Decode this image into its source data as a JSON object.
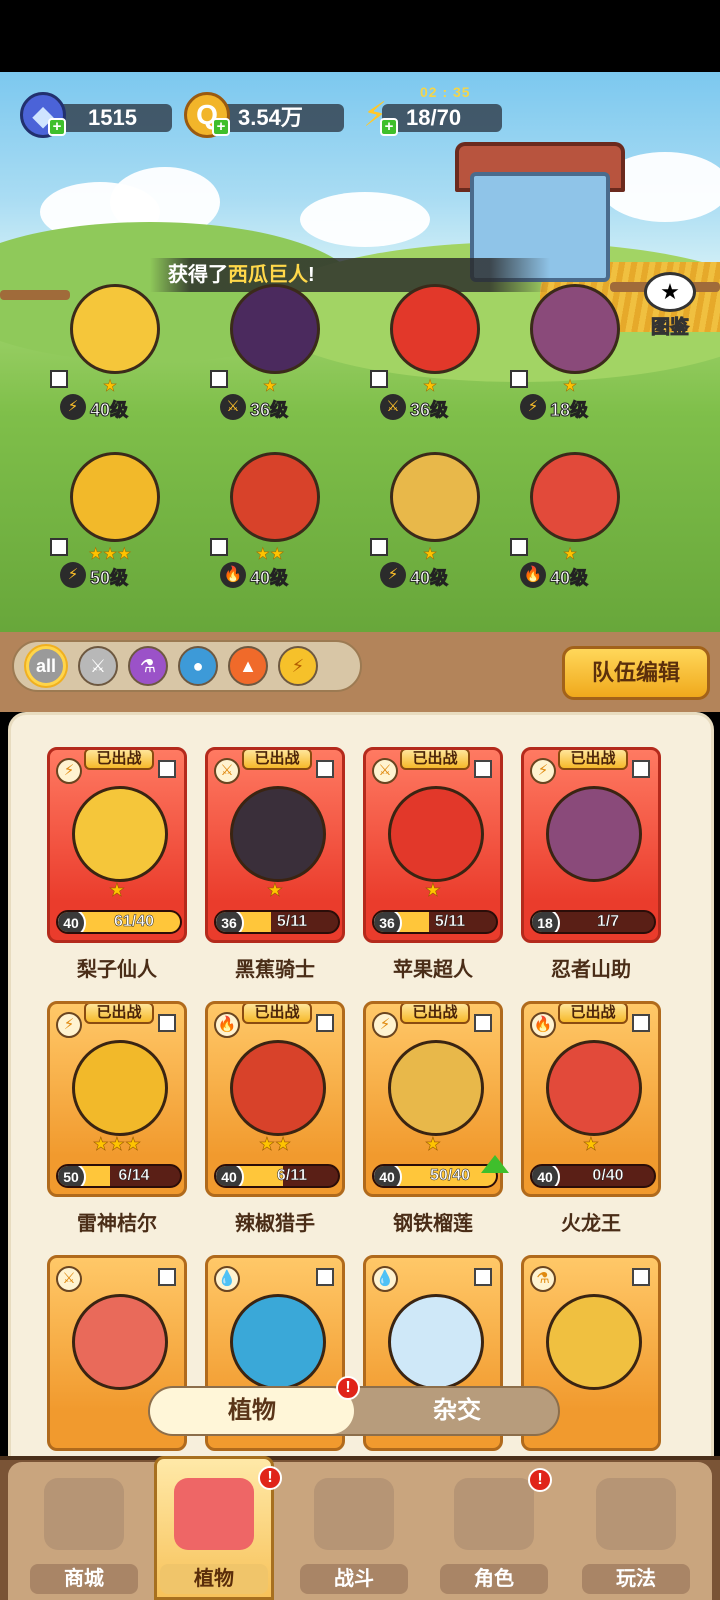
{
  "currency": {
    "gems": "1515",
    "coins": "3.54万",
    "energy": "18/70",
    "energy_timer": "02 : 35"
  },
  "announcement": {
    "prefix": "获得了",
    "highlight": "西瓜巨人",
    "suffix": "!"
  },
  "codex_label": "图鉴",
  "field_plants": [
    {
      "element": "lightning",
      "level": "40级",
      "stars": "★",
      "color": "#f5c63a"
    },
    {
      "element": "sword",
      "level": "36级",
      "stars": "★",
      "color": "#4b2a5e"
    },
    {
      "element": "sword",
      "level": "36级",
      "stars": "★",
      "color": "#e2382a"
    },
    {
      "element": "lightning",
      "level": "18级",
      "stars": "★",
      "color": "#8a4a7a"
    },
    {
      "element": "lightning",
      "level": "50级",
      "stars": "★★★",
      "color": "#f2b92a"
    },
    {
      "element": "fire",
      "level": "40级",
      "stars": "★★",
      "color": "#d8422a"
    },
    {
      "element": "lightning",
      "level": "40级",
      "stars": "★",
      "color": "#e8b84a"
    },
    {
      "element": "fire",
      "level": "40级",
      "stars": "★",
      "color": "#e24a3a"
    }
  ],
  "filters": [
    "all",
    "sword-icon",
    "potion-icon",
    "water-icon",
    "fire-icon",
    "lightning-icon"
  ],
  "team_edit_label": "队伍编辑",
  "deployed_label": "已出战",
  "cards": [
    {
      "name": "梨子仙人",
      "level": "40",
      "progress": "61/40",
      "fill": 1.0,
      "stars": "★",
      "element": "⚡",
      "style": "red",
      "color": "#f5c63a"
    },
    {
      "name": "黑蕉骑士",
      "level": "36",
      "progress": "5/11",
      "fill": 0.45,
      "stars": "★",
      "element": "⚔",
      "style": "red",
      "color": "#3a2f3a"
    },
    {
      "name": "苹果超人",
      "level": "36",
      "progress": "5/11",
      "fill": 0.45,
      "stars": "★",
      "element": "⚔",
      "style": "red",
      "color": "#e2382a"
    },
    {
      "name": "忍者山助",
      "level": "18",
      "progress": "1/7",
      "fill": 0.14,
      "stars": "",
      "element": "⚡",
      "style": "red",
      "color": "#8a4a7a"
    },
    {
      "name": "雷神桔尔",
      "level": "50",
      "progress": "6/14",
      "fill": 0.43,
      "stars": "★★★",
      "element": "⚡",
      "style": "gold",
      "color": "#f2b92a"
    },
    {
      "name": "辣椒猎手",
      "level": "40",
      "progress": "6/11",
      "fill": 0.55,
      "stars": "★★",
      "element": "🔥",
      "style": "gold",
      "color": "#d8422a"
    },
    {
      "name": "钢铁榴莲",
      "level": "40",
      "progress": "50/40",
      "fill": 1.0,
      "stars": "★",
      "element": "⚡",
      "style": "gold",
      "color": "#e8b84a"
    },
    {
      "name": "火龙王",
      "level": "40",
      "progress": "0/40",
      "fill": 0.0,
      "stars": "★",
      "element": "🔥",
      "style": "gold",
      "color": "#e24a3a"
    }
  ],
  "partial_cards": [
    {
      "element": "⚔",
      "color": "#e96a5a"
    },
    {
      "element": "💧",
      "color": "#3aa8d8"
    },
    {
      "element": "💧",
      "color": "#cfe8f8"
    },
    {
      "element": "⚗",
      "color": "#f0c040"
    }
  ],
  "segment": {
    "plants": "植物",
    "hybrid": "杂交"
  },
  "nav": [
    {
      "label": "商城",
      "icon": "shop-icon"
    },
    {
      "label": "植物",
      "icon": "plants-icon"
    },
    {
      "label": "战斗",
      "icon": "battle-icon"
    },
    {
      "label": "角色",
      "icon": "character-icon"
    },
    {
      "label": "玩法",
      "icon": "gameplay-icon"
    }
  ],
  "alert_mark": "!"
}
